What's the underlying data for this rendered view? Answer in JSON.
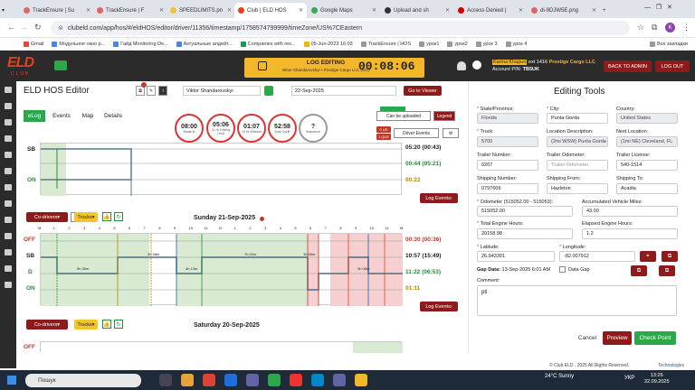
{
  "browser": {
    "tabs": [
      "TrackEnsure | Su",
      "TrackEnsure | F",
      "SPEEDLIMITS.pn",
      "Club | ELD HOS",
      "Google Maps",
      "Upload and sh",
      "Access Denied |",
      "di-9DJW5E.png"
    ],
    "tab_colors": [
      "#e06666",
      "#e06666",
      "#f1c232",
      "#e8401b",
      "#34a853",
      "#333333",
      "#cc0000",
      "#e06666"
    ],
    "url": "clubeld.com/app/hos/#/eldHOS/editor/driver/11356/timestamp/1758574799999/timeZone/US%7CEastern",
    "bookmarks": [
      "Gmail",
      "Модульное окно р...",
      "Гайд Monitoring De...",
      "Актуальные апдейт...",
      "Companies with res...",
      "05-Jun-2023 16:03",
      "TrackEnsure | HOS",
      "урок1",
      "урок2",
      "урок 3",
      "урок 4"
    ],
    "all_bookmarks": "Все закладки",
    "profile_initial": "K"
  },
  "header": {
    "logo": "ELD",
    "logo_sub": "CLUB",
    "edit_title": "LOG EDITING",
    "edit_sub": "Viktor Shandarovskyi • Prestige Cargo LLC (MO)",
    "timer": "00:08:06",
    "badge": "21",
    "user_name": "Karina Khapun",
    "user_ext": "ext 1416",
    "company": "Prestige Cargo LLC",
    "account_pin_label": "Account PIN:",
    "account_pin": "TB5UK",
    "back_admin": "BACK TO ADMIN",
    "logout": "LOG OUT"
  },
  "editor": {
    "title": "ELD HOS Editor",
    "driver": "Viktor Shandarovskyi",
    "date": "22-Sep-2025",
    "go_viewer": "Go to Viewer",
    "tabs": [
      "eLog",
      "Events",
      "Map",
      "Details"
    ],
    "gauges": [
      {
        "value": "08:00",
        "label": "Break In"
      },
      {
        "value": "05:06",
        "label": "11 Hr Driving Limit"
      },
      {
        "value": "01:07",
        "label": "14 Hr Window"
      },
      {
        "value": "52:58",
        "label": "Duty Cycle"
      },
      {
        "value": "?",
        "label": "Sequence"
      }
    ],
    "can_be_uploaded": "Can be uploaded",
    "legend": "Legend",
    "driver_events": "Driver Events",
    "ue": "0 UE",
    "que": "1 QUE",
    "log_events": "Log Events",
    "co_drivers": "Co-drivers",
    "trucks": "Trucks"
  },
  "day1": {
    "rows": [
      "SB",
      "ON"
    ],
    "totals": [
      "05:20 (00:43)",
      "00:44 (05:21)",
      "00:22"
    ]
  },
  "day2": {
    "title": "Sunday 21-Sep-2025",
    "rows": [
      "OFF",
      "SB",
      "D",
      "ON"
    ],
    "totals": [
      "00:30 (00:36)",
      "10:57 (15:49)",
      "11:22 (06:53)",
      "01:11"
    ],
    "hours": [
      "M",
      "1",
      "2",
      "3",
      "4",
      "5",
      "6",
      "7",
      "8",
      "9",
      "10",
      "11",
      "N",
      "1",
      "2",
      "3",
      "4",
      "5",
      "6",
      "7",
      "8",
      "9",
      "10",
      "11",
      "M"
    ],
    "segment_labels": [
      "3h 48m",
      "7h 02m",
      "1h 00m",
      "4h 13m",
      "5h 30m",
      "4h 08m"
    ]
  },
  "day3": {
    "title": "Saturday 20-Sep-2025",
    "rows": [
      "OFF"
    ]
  },
  "tools": {
    "title": "Editing Tools",
    "state_label": "State/Province:",
    "state": "Florida",
    "city_label": "City:",
    "city": "Punta Gorda",
    "country_label": "Country:",
    "country": "United States",
    "truck_label": "Truck:",
    "truck": "5700",
    "loc_desc_label": "Location Description:",
    "loc_desc": "(2mi WSW) Punta Gorda",
    "next_loc_label": "Next Location:",
    "next_loc": "(1mi NE) Cleveland, FL",
    "trailer_label": "Trailer Number:",
    "trailer": "0207",
    "trailer_odo_label": "Trailer Odometer:",
    "trailer_odo": "Trailer Odometer",
    "trailer_lic_label": "Trailer License:",
    "trailer_lic": "540-1514",
    "ship_num_label": "Shipping Number:",
    "ship_num": "0797609",
    "ship_from_label": "Shipping From:",
    "ship_from": "Hazleton",
    "ship_to_label": "Shipping To:",
    "ship_to": "Acadia",
    "odo_label": "Odometer (515052.00 - 515053):",
    "odo": "515052.00",
    "veh_miles_label": "Accumulated Vehicle Miles:",
    "veh_miles": "43.00",
    "eng_hours_label": "Total Engine Hours:",
    "eng_hours": "20158.98",
    "elapsed_label": "Elapsed Engine Hours:",
    "elapsed": "1.2",
    "lat_label": "Latitude:",
    "lat": "26.943301",
    "lon_label": "Longitude:",
    "lon": "-82.007912",
    "gap_label": "Gap Data:",
    "gap_value": "13-Sep-2025 6:01 AM",
    "data_gap": "Data Gap",
    "comment_label": "Comment:",
    "comment": "pti",
    "cancel": "Cancel",
    "preview": "Preview",
    "checkpoint": "Check Point"
  },
  "footer": "© Club ELD . 2025 All Rights Reserved.",
  "footer_brand": "Technologies",
  "taskbar": {
    "search": "Пошук",
    "weather": "24°C  Sunny",
    "lang": "УКР",
    "time": "13:26",
    "date": "22.09.2025"
  }
}
